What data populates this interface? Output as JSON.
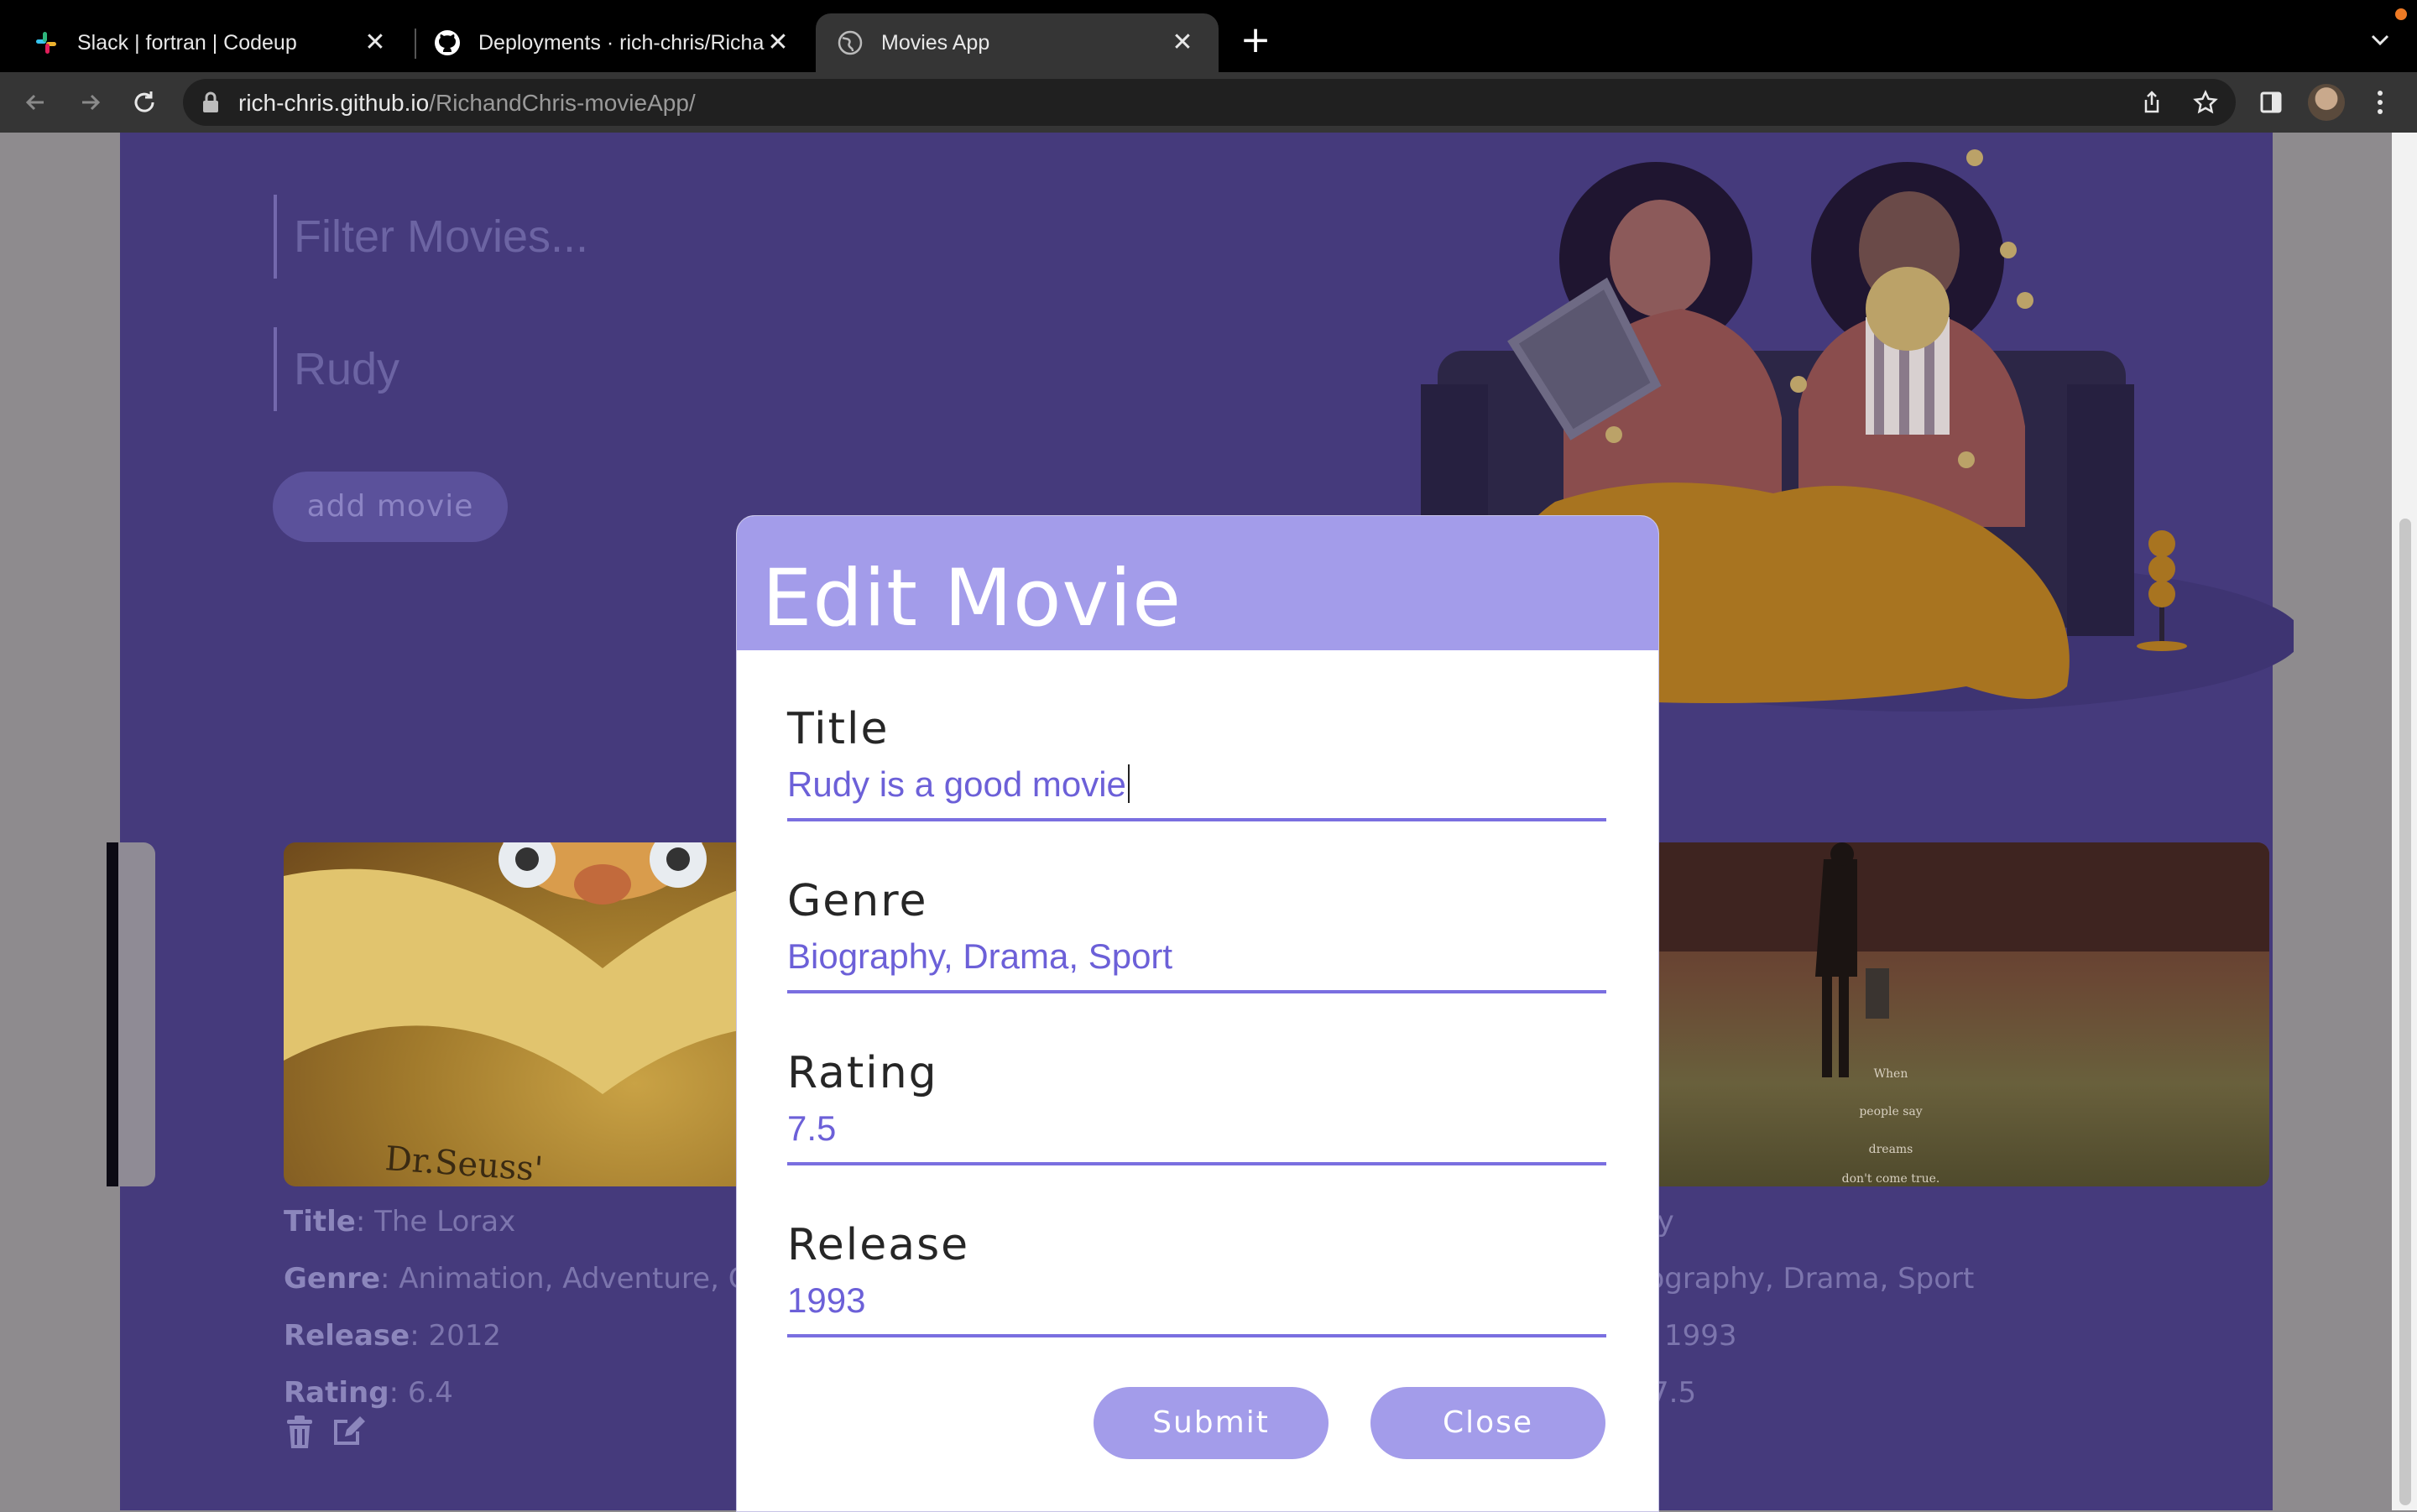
{
  "browser": {
    "tabs": [
      {
        "label": "Slack | fortran | Codeup",
        "icon": "slack-icon"
      },
      {
        "label": "Deployments · rich-chris/Richa",
        "icon": "github-icon"
      },
      {
        "label": "Movies App",
        "icon": "globe-icon",
        "active": true
      }
    ],
    "url_host": "rich-chris.github.io",
    "url_path": "/RichandChris-movieApp/"
  },
  "page": {
    "filter_placeholder": "Filter Movies...",
    "title_input_value": "Rudy",
    "add_button": "add movie",
    "movies": [
      {
        "title_label": "Title",
        "title": "The Lorax",
        "genre_label": "Genre",
        "genre": "Animation, Adventure, C",
        "release_label": "Release",
        "release": "2012",
        "rating_label": "Rating",
        "rating": "6.4"
      },
      {
        "title": "dy",
        "genre": "iography, Drama, Sport",
        "release": "1993",
        "rating": "7.5"
      }
    ]
  },
  "modal": {
    "title": "Edit Movie",
    "fields": [
      {
        "label": "Title",
        "value": "Rudy is a good movie"
      },
      {
        "label": "Genre",
        "value": "Biography, Drama, Sport"
      },
      {
        "label": "Rating",
        "value": "7.5"
      },
      {
        "label": "Release",
        "value": "1993"
      }
    ],
    "submit": "Submit",
    "close": "Close"
  },
  "colors": {
    "page_bg": "#453a7c",
    "modal_header": "#a39cea",
    "input_text": "#6c60d8"
  }
}
